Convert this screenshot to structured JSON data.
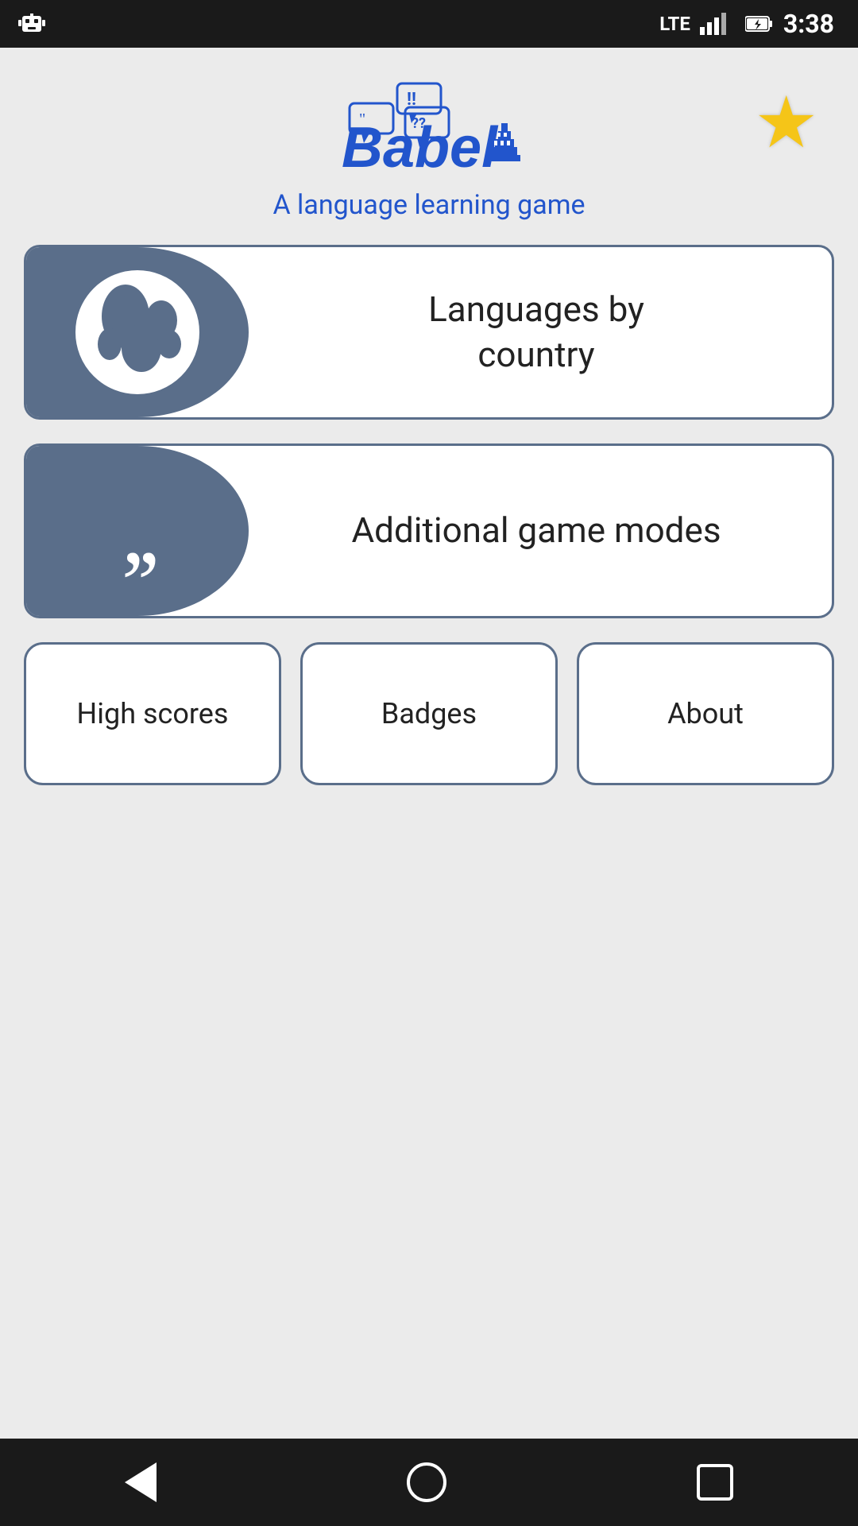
{
  "statusBar": {
    "time": "3:38",
    "signal": "LTE",
    "battery": "charging"
  },
  "header": {
    "appName": "Babel",
    "subtitle": "A language learning game",
    "starLabel": "favorites-star"
  },
  "mainButtons": [
    {
      "id": "languages-by-country",
      "label": "Languages by\ncountry",
      "icon": "globe-icon"
    },
    {
      "id": "additional-game-modes",
      "label": "Additional game modes",
      "icon": "quotes-icon"
    }
  ],
  "smallButtons": [
    {
      "id": "high-scores",
      "label": "High scores"
    },
    {
      "id": "badges",
      "label": "Badges"
    },
    {
      "id": "about",
      "label": "About"
    }
  ],
  "navBar": {
    "backLabel": "back",
    "homeLabel": "home",
    "recentsLabel": "recents"
  }
}
